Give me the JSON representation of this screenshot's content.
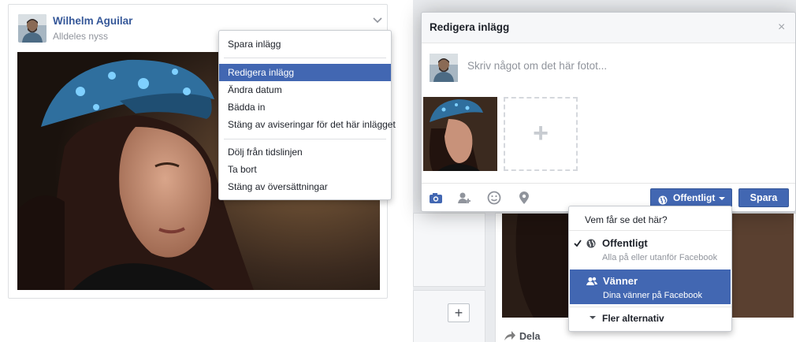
{
  "post": {
    "author": "Wilhelm Aguilar",
    "timestamp": "Alldeles nyss",
    "menu": {
      "items_group1": [
        "Spara inlägg"
      ],
      "items_group2": [
        "Redigera inlägg",
        "Ändra datum",
        "Bädda in",
        "Stäng av aviseringar för det här inlägget"
      ],
      "items_group3": [
        "Dölj från tidslinjen",
        "Ta bort",
        "Stäng av översättningar"
      ],
      "selected": "Redigera inlägg"
    }
  },
  "background_feed": {
    "add_button": "+",
    "share_label": "Dela"
  },
  "modal": {
    "title": "Redigera inlägg",
    "close": "×",
    "composer_placeholder": "Skriv något om det här fotot...",
    "add_photo": "+",
    "footer_icons": [
      "camera-icon",
      "tag-friends-icon",
      "emoji-icon",
      "location-pin-icon"
    ],
    "audience_button": "Offentligt",
    "save_button": "Spara"
  },
  "audience_menu": {
    "title": "Vem får se det här?",
    "options": [
      {
        "label": "Offentligt",
        "sub": "Alla på eller utanför Facebook",
        "checked": true,
        "icon": "globe-icon"
      },
      {
        "label": "Vänner",
        "sub": "Dina vänner på Facebook",
        "highlighted": true,
        "icon": "friends-icon"
      }
    ],
    "more": "Fler alternativ"
  },
  "colors": {
    "brand_blue": "#4267b2",
    "link_blue": "#365899",
    "page_bg": "#e9ebee"
  }
}
